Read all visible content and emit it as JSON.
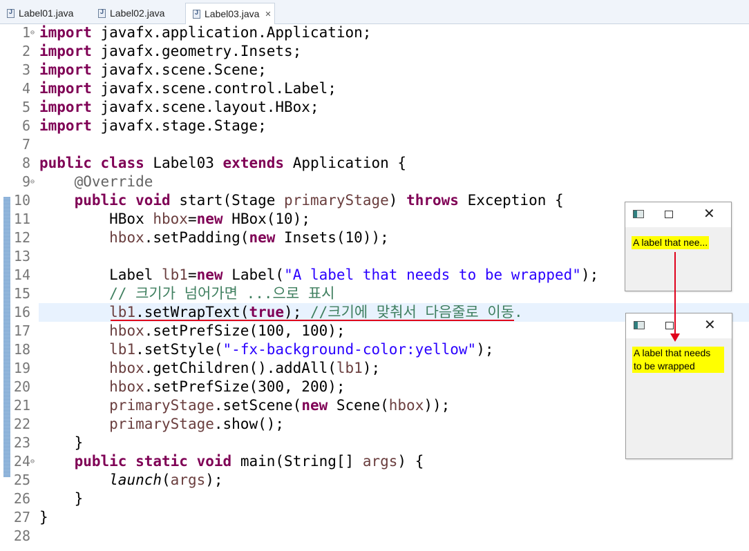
{
  "tabs": [
    {
      "label": "Label01.java",
      "active": false
    },
    {
      "label": "Label02.java",
      "active": false
    },
    {
      "label": "Label03.java",
      "active": true
    }
  ],
  "tab_close_glyph": "✕",
  "editor": {
    "highlight_line": 16,
    "lines": [
      {
        "n": "1",
        "fold": "⊖",
        "html": "<span class='kw'>import</span> javafx.application.Application;"
      },
      {
        "n": "2",
        "fold": "",
        "html": "<span class='kw'>import</span> javafx.geometry.Insets;"
      },
      {
        "n": "3",
        "fold": "",
        "html": "<span class='kw'>import</span> javafx.scene.Scene;"
      },
      {
        "n": "4",
        "fold": "",
        "html": "<span class='kw'>import</span> javafx.scene.control.Label;"
      },
      {
        "n": "5",
        "fold": "",
        "html": "<span class='kw'>import</span> javafx.scene.layout.HBox;"
      },
      {
        "n": "6",
        "fold": "",
        "html": "<span class='kw'>import</span> javafx.stage.Stage;"
      },
      {
        "n": "7",
        "fold": "",
        "html": ""
      },
      {
        "n": "8",
        "fold": "",
        "html": "<span class='kw'>public</span> <span class='kw'>class</span> Label03 <span class='kw'>extends</span> Application {"
      },
      {
        "n": "9",
        "fold": "⊖",
        "html": "    <span class='ann'>@Override</span>"
      },
      {
        "n": "10",
        "fold": "",
        "html": "    <span class='kw'>public</span> <span class='kw'>void</span> start(Stage <span class='var'>primaryStage</span>) <span class='kw'>throws</span> Exception {"
      },
      {
        "n": "11",
        "fold": "",
        "html": "        HBox <span class='var'>hbox</span>=<span class='kw'>new</span> HBox(10);"
      },
      {
        "n": "12",
        "fold": "",
        "html": "        <span class='var'>hbox</span>.setPadding(<span class='kw'>new</span> Insets(10));"
      },
      {
        "n": "13",
        "fold": "",
        "html": ""
      },
      {
        "n": "14",
        "fold": "",
        "html": "        Label <span class='var'>lb1</span>=<span class='kw'>new</span> Label(<span class='str'>\"A label that needs to be wrapped\"</span>);"
      },
      {
        "n": "15",
        "fold": "",
        "html": "        <span class='cm'>// 크기가 넘어가면 ...으로 표시</span>"
      },
      {
        "n": "16",
        "fold": "",
        "html": "        <span class='var'>lb1</span>.setWrapText(<span class='kw'>true</span>); <span class='cm'>//크기에 맞춰서 다음줄로 이동.</span>"
      },
      {
        "n": "17",
        "fold": "",
        "html": "        <span class='var'>hbox</span>.setPrefSize(100, 100);"
      },
      {
        "n": "18",
        "fold": "",
        "html": "        <span class='var'>lb1</span>.setStyle(<span class='str'>\"-fx-background-color:yellow\"</span>);"
      },
      {
        "n": "19",
        "fold": "",
        "html": "        <span class='var'>hbox</span>.getChildren().addAll(<span class='var'>lb1</span>);"
      },
      {
        "n": "20",
        "fold": "",
        "html": "        <span class='var'>hbox</span>.setPrefSize(300, 200);"
      },
      {
        "n": "21",
        "fold": "",
        "html": "        <span class='var'>primaryStage</span>.setScene(<span class='kw'>new</span> Scene(<span class='var'>hbox</span>));"
      },
      {
        "n": "22",
        "fold": "",
        "html": "        <span class='var'>primaryStage</span>.show();"
      },
      {
        "n": "23",
        "fold": "",
        "html": "    }"
      },
      {
        "n": "24",
        "fold": "⊖",
        "html": "    <span class='kw'>public</span> <span class='kw'>static</span> <span class='kw'>void</span> main(String[] <span class='var'>args</span>) {"
      },
      {
        "n": "25",
        "fold": "",
        "html": "        <span class='st'>launch</span>(<span class='var'>args</span>);"
      },
      {
        "n": "26",
        "fold": "",
        "html": "    }"
      },
      {
        "n": "27",
        "fold": "",
        "html": "}"
      },
      {
        "n": "28",
        "fold": "",
        "html": ""
      }
    ]
  },
  "window_before": {
    "label": "A label that nee..."
  },
  "window_after": {
    "label_line1": "A label that needs",
    "label_line2": "to be wrapped"
  },
  "colors": {
    "annotation": "#e0001b",
    "label_bg": "#ffff00",
    "keyword": "#7f0055",
    "string": "#2a00ff",
    "comment": "#3f7f5f"
  }
}
